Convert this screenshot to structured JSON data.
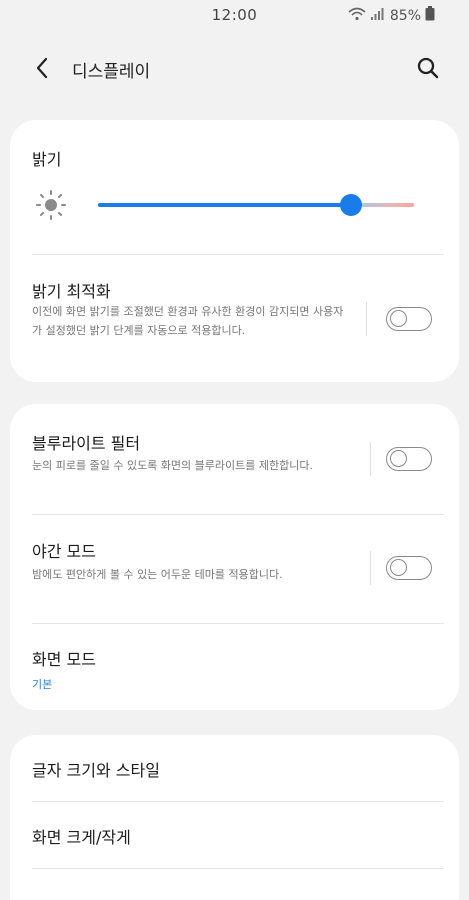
{
  "status": {
    "time": "12:00",
    "battery": "85%"
  },
  "header": {
    "title": "디스플레이"
  },
  "brightness": {
    "title": "밝기",
    "level": 0.8,
    "adaptive_title": "밝기 최적화",
    "adaptive_desc": "이전에 화면 밝기를 조절했던 환경과 유사한 환경이 감지되면 사용자가 설정했던 밝기 단계를 자동으로 적용합니다.",
    "adaptive_on": false
  },
  "blue_light": {
    "title": "블루라이트 필터",
    "desc": "눈의 피로를 줄일 수 있도록 화면의 블루라이트를 제한합니다.",
    "on": false
  },
  "night_mode": {
    "title": "야간 모드",
    "desc": "밤에도 편안하게 볼 수 있는 어두운 테마를 적용합니다.",
    "on": false
  },
  "screen_mode": {
    "title": "화면 모드",
    "value": "기본"
  },
  "font": {
    "title": "글자 크기와 스타일"
  },
  "zoom": {
    "title": "화면 크게/작게"
  },
  "colors": {
    "accent": "#1a7ce8",
    "background": "#f2f2f2",
    "card": "#ffffff"
  }
}
